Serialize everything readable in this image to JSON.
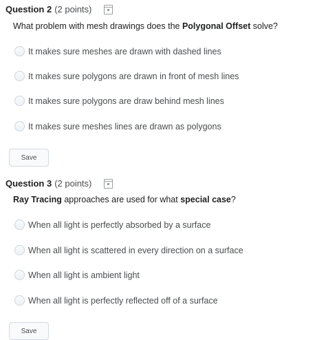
{
  "questions": [
    {
      "title": "Question 2",
      "points": "(2 points)",
      "prompt_pre": "What problem with mesh drawings does the ",
      "prompt_bold": "Polygonal Offset",
      "prompt_post": " solve?",
      "options": [
        "It makes sure meshes are drawn with dashed lines",
        "It makes sure polygons are drawn in front of mesh lines",
        "It makes sure polygons are draw behind mesh lines",
        "It makes sure meshes lines are drawn as polygons"
      ],
      "save_label": "Save"
    },
    {
      "title": "Question 3",
      "points": "(2 points)",
      "prompt_bold1": "Ray Tracing",
      "prompt_mid": " approaches are used for what ",
      "prompt_bold2": "special case",
      "prompt_post": "?",
      "options": [
        "When all light is perfectly absorbed by a surface",
        "When all light is scattered in every direction on a surface",
        "When all light is ambient light",
        "When all light is perfectly reflected off of a surface"
      ],
      "save_label": "Save"
    }
  ]
}
